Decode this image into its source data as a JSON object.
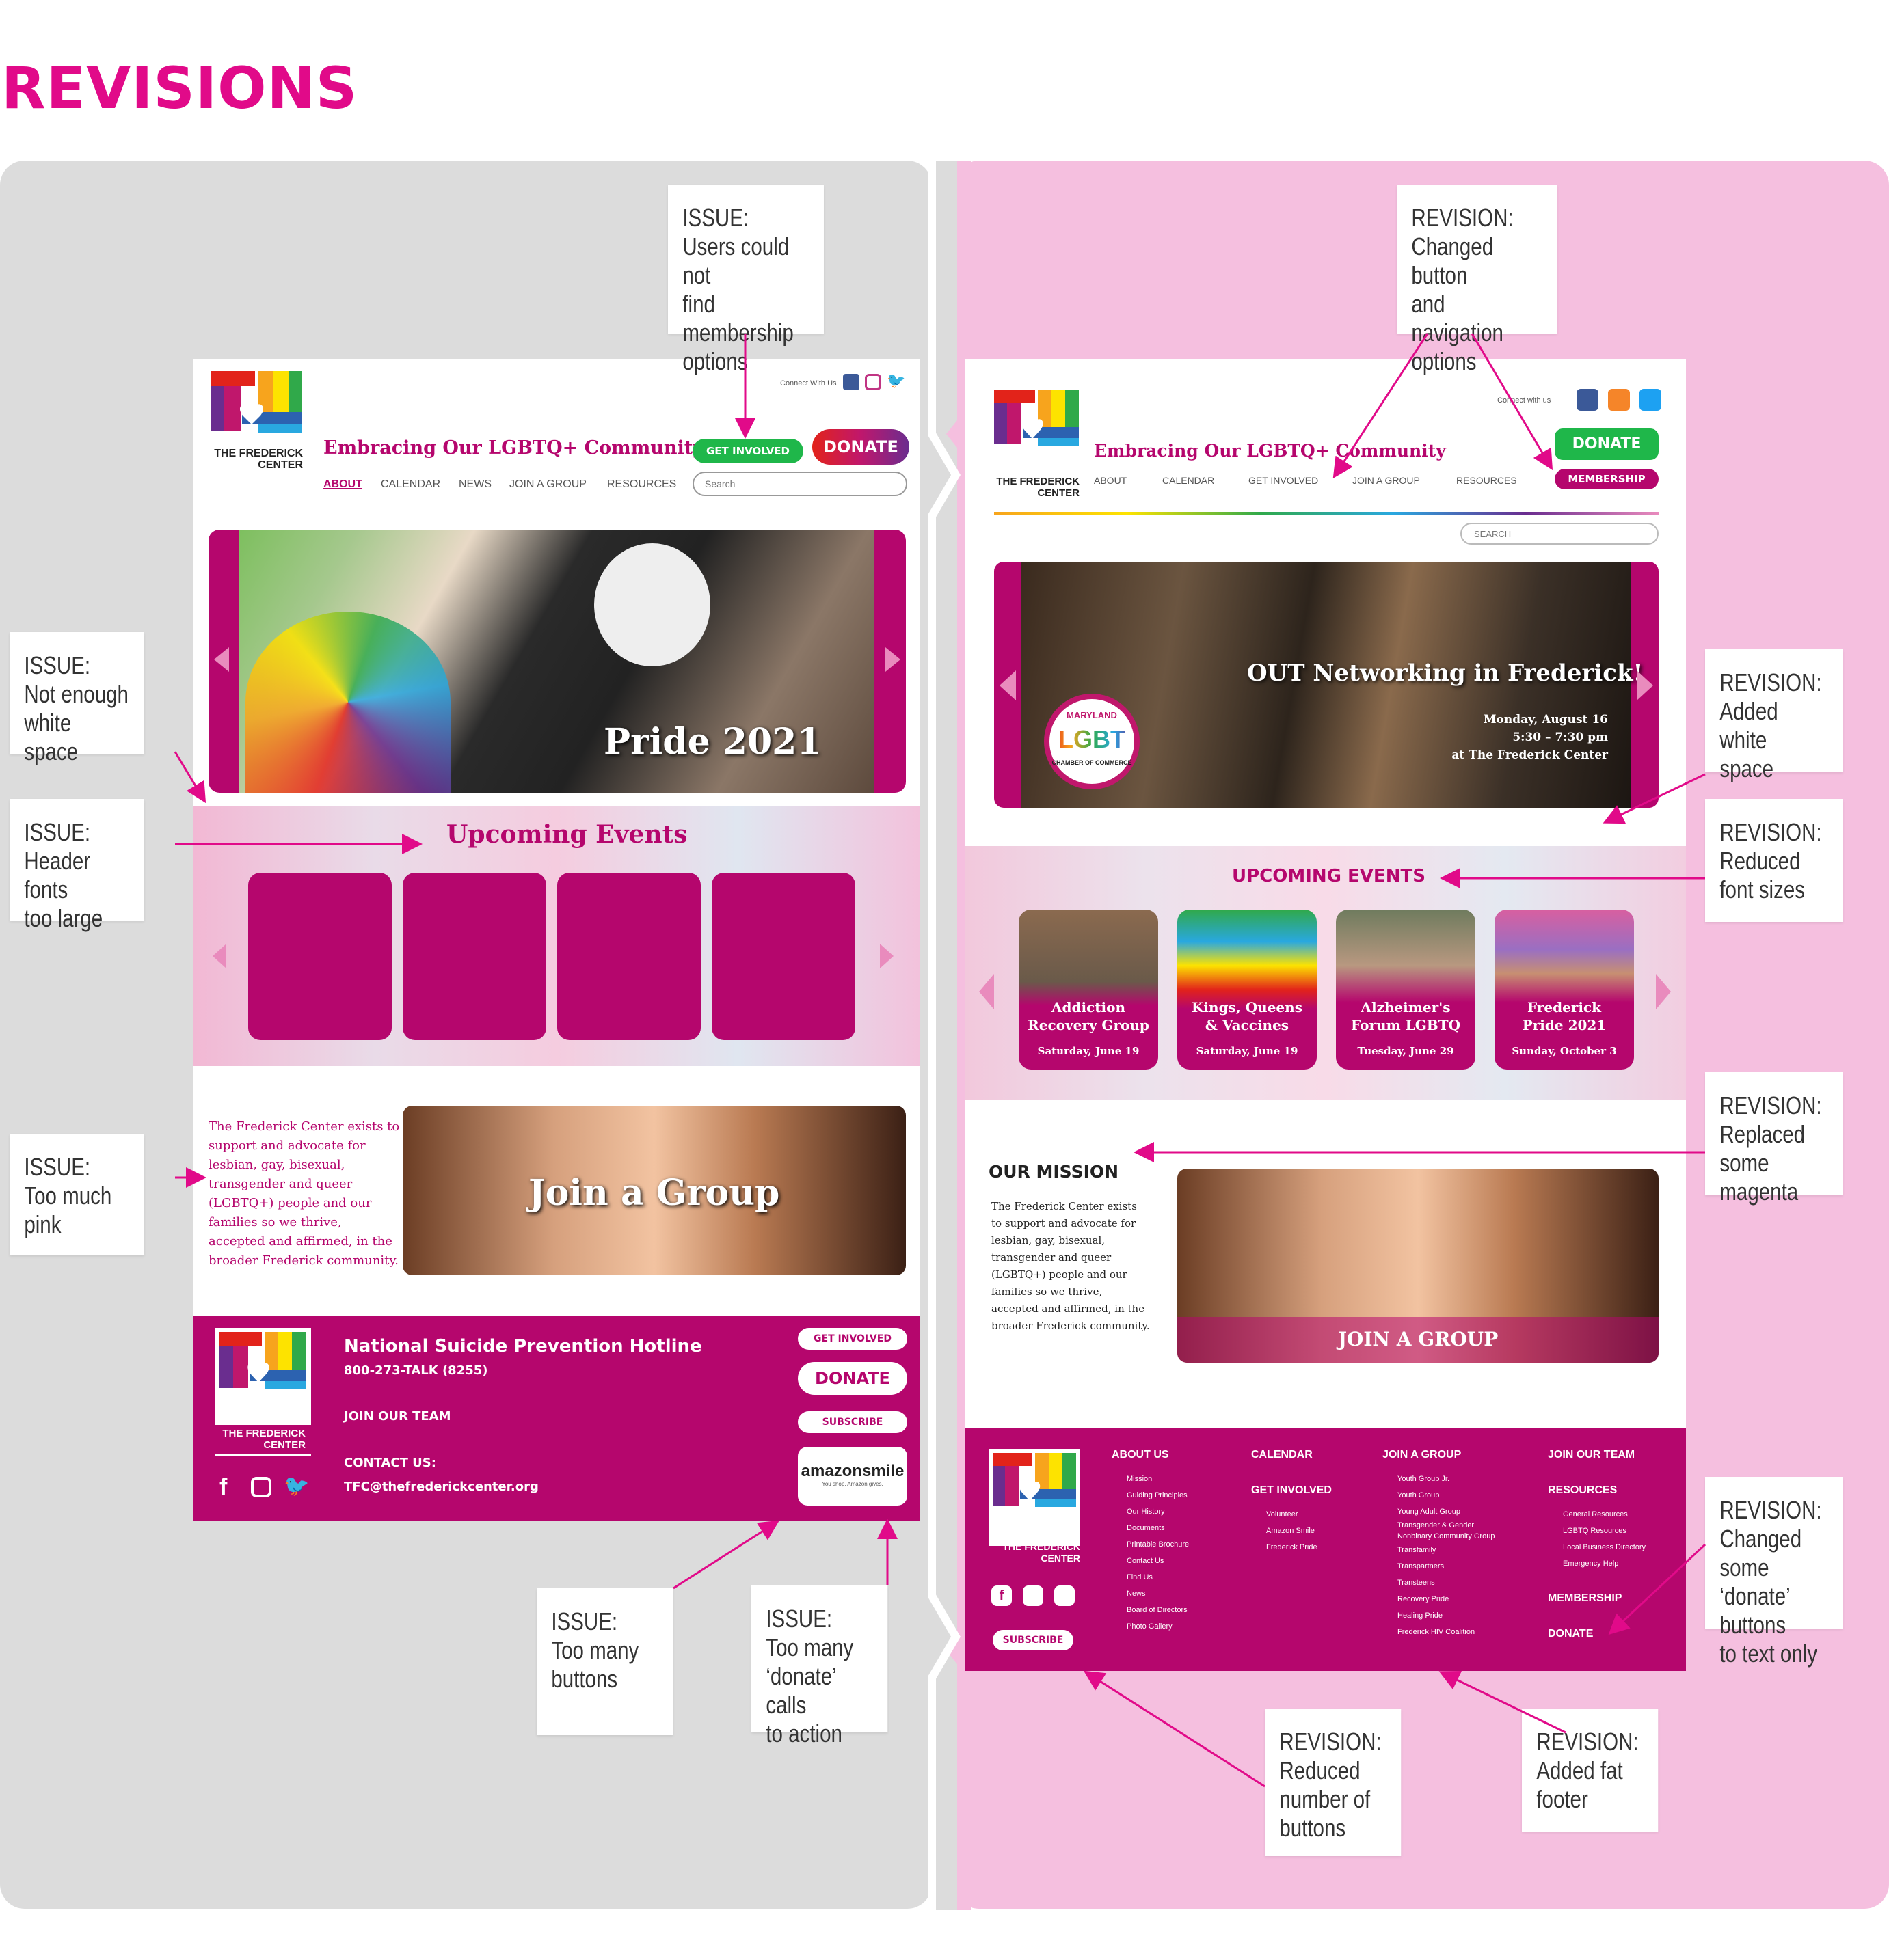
{
  "page_title": "REVISIONS",
  "colors": {
    "magenta": "#b5066d",
    "pink_accent": "#e10a89",
    "left_bg": "#dcdcdc",
    "right_bg": "#f5bfdf",
    "green": "#1fb74a"
  },
  "left": {
    "connect": "Connect With Us",
    "tagline": "Embracing Our LGBTQ+ Community",
    "get_involved": "GET INVOLVED",
    "donate": "DONATE",
    "nav": [
      "ABOUT",
      "CALENDAR",
      "NEWS",
      "JOIN A GROUP",
      "RESOURCES"
    ],
    "search_placeholder": "Search",
    "logo_text_1": "THE FREDERICK",
    "logo_text_2": "CENTER",
    "hero_caption": "Pride 2021",
    "events_title": "Upcoming Events",
    "mission": "The Frederick Center exists to support and advocate for lesbian, gay, bisexual, transgender and queer (LGBTQ+) people and our families so we thrive, accepted and affirmed, in the broader Frederick community.",
    "join_group": "Join a Group",
    "footer": {
      "hotline": "National Suicide Prevention Hotline",
      "phone": "800-273-TALK (8255)",
      "join_team": "JOIN OUR TEAM",
      "contact": "CONTACT US:",
      "email": "TFC@thefrederickcenter.org",
      "btn_get_involved": "GET INVOLVED",
      "btn_donate": "DONATE",
      "btn_subscribe": "SUBSCRIBE",
      "amazon": "amazonsmile",
      "amazon_sub": "You shop. Amazon gives."
    }
  },
  "right": {
    "connect": "Connect with us",
    "tagline": "Embracing Our LGBTQ+ Community",
    "donate": "DONATE",
    "membership": "MEMBERSHIP",
    "nav": [
      "ABOUT",
      "CALENDAR",
      "GET INVOLVED",
      "JOIN A GROUP",
      "RESOURCES"
    ],
    "search_placeholder": "SEARCH",
    "logo_text_1": "THE FREDERICK",
    "logo_text_2": "CENTER",
    "hero_title": "OUT Networking in Frederick!",
    "hero_line1": "Monday, August 16",
    "hero_line2": "5:30 – 7:30 pm",
    "hero_line3": "at The Frederick Center",
    "badge_top": "MARYLAND",
    "badge_mid": "LGBT",
    "badge_bottom": "CHAMBER OF COMMERCE",
    "events_title": "UPCOMING EVENTS",
    "events": [
      {
        "title_1": "Addiction",
        "title_2": "Recovery Group",
        "date": "Saturday, June 19"
      },
      {
        "title_1": "Kings, Queens",
        "title_2": "& Vaccines",
        "date": "Saturday, June 19"
      },
      {
        "title_1": "Alzheimer's",
        "title_2": "Forum LGBTQ",
        "date": "Tuesday, June 29"
      },
      {
        "title_1": "Frederick",
        "title_2": "Pride 2021",
        "date": "Sunday, October 3"
      }
    ],
    "mission_title": "OUR MISSION",
    "mission": "The Frederick Center exists to support and advocate for lesbian, gay, bisexual, transgender and queer (LGBTQ+) people and our families so we thrive, accepted and affirmed, in the broader Frederick community.",
    "join_group": "JOIN A GROUP",
    "subscribe": "SUBSCRIBE",
    "footer_cols": {
      "about": {
        "h": "ABOUT US",
        "items": [
          "Mission",
          "Guiding Principles",
          "Our History",
          "Documents",
          "Printable Brochure",
          "Contact Us",
          "Find Us",
          "News",
          "Board of Directors",
          "Photo Gallery"
        ]
      },
      "calendar": {
        "h": "CALENDAR"
      },
      "get_involved": {
        "h": "GET INVOLVED",
        "items": [
          "Volunteer",
          "Amazon Smile",
          "Frederick Pride"
        ]
      },
      "join_group": {
        "h": "JOIN A GROUP",
        "items": [
          "Youth Group Jr.",
          "Youth Group",
          "Young Adult Group",
          "Transgender & Gender",
          "Nonbinary Community Group",
          "Transfamily",
          "Transpartners",
          "Transteens",
          "Recovery Pride",
          "Healing Pride",
          "Frederick HIV Coalition"
        ]
      },
      "join_team": {
        "h": "JOIN OUR TEAM"
      },
      "resources": {
        "h": "RESOURCES",
        "items": [
          "General Resources",
          "LGBTQ Resources",
          "Local Business Directory",
          "Emergency Help"
        ]
      },
      "membership": {
        "h": "MEMBERSHIP"
      },
      "donate": {
        "h": "DONATE"
      }
    }
  },
  "notes": {
    "issue_membership": [
      "ISSUE:",
      "Users could not",
      "find membership",
      "options"
    ],
    "issue_whitespace": [
      "ISSUE:",
      "Not enough",
      "white space"
    ],
    "issue_header": [
      "ISSUE:",
      "Header fonts",
      "too large"
    ],
    "issue_pink": [
      "ISSUE:",
      "Too much pink"
    ],
    "issue_buttons": [
      "ISSUE:",
      "Too many",
      "buttons"
    ],
    "issue_donate": [
      "ISSUE:",
      "Too many",
      "‘donate’ calls",
      "to action"
    ],
    "rev_nav": [
      "REVISION:",
      "Changed button",
      "and navigation",
      "options"
    ],
    "rev_whitespace": [
      "REVISION:",
      "Added white",
      "space"
    ],
    "rev_font": [
      "REVISION:",
      "Reduced",
      "font sizes"
    ],
    "rev_magenta": [
      "REVISION:",
      "Replaced",
      "some magenta"
    ],
    "rev_donate": [
      "REVISION:",
      "Changed some",
      "‘donate’ buttons",
      "to text only"
    ],
    "rev_buttons": [
      "REVISION:",
      "Reduced",
      "number of",
      "buttons"
    ],
    "rev_footer": [
      "REVISION:",
      "Added fat",
      "footer"
    ]
  }
}
